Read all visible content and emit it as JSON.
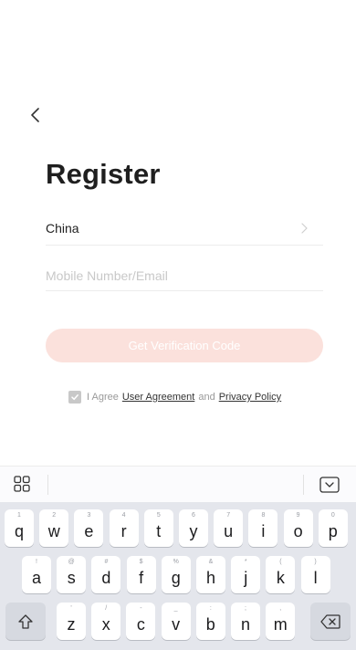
{
  "page": {
    "title": "Register",
    "country": "China",
    "account_placeholder": "Mobile Number/Email",
    "get_code_label": "Get Verification Code",
    "agree": {
      "prefix": "I Agree",
      "user_agreement": "User Agreement",
      "and": "and",
      "privacy_policy": "Privacy Policy",
      "checked": true
    }
  },
  "keyboard": {
    "toolbar": {
      "left_icon": "grid-icon",
      "right_icon": "hide-keyboard-icon"
    },
    "row1": [
      {
        "main": "q",
        "sub": "1"
      },
      {
        "main": "w",
        "sub": "2"
      },
      {
        "main": "e",
        "sub": "3"
      },
      {
        "main": "r",
        "sub": "4"
      },
      {
        "main": "t",
        "sub": "5"
      },
      {
        "main": "y",
        "sub": "6"
      },
      {
        "main": "u",
        "sub": "7"
      },
      {
        "main": "i",
        "sub": "8"
      },
      {
        "main": "o",
        "sub": "9"
      },
      {
        "main": "p",
        "sub": "0"
      }
    ],
    "row2": [
      {
        "main": "a",
        "sub": "!"
      },
      {
        "main": "s",
        "sub": "@"
      },
      {
        "main": "d",
        "sub": "#"
      },
      {
        "main": "f",
        "sub": "$"
      },
      {
        "main": "g",
        "sub": "%"
      },
      {
        "main": "h",
        "sub": "&"
      },
      {
        "main": "j",
        "sub": "*"
      },
      {
        "main": "k",
        "sub": "("
      },
      {
        "main": "l",
        "sub": ")"
      }
    ],
    "row3": [
      {
        "main": "z",
        "sub": "'"
      },
      {
        "main": "x",
        "sub": "/"
      },
      {
        "main": "c",
        "sub": "-"
      },
      {
        "main": "v",
        "sub": "_"
      },
      {
        "main": "b",
        "sub": ":"
      },
      {
        "main": "n",
        "sub": ";"
      },
      {
        "main": "m",
        "sub": ","
      }
    ],
    "shift_icon": "shift-icon",
    "backspace_icon": "backspace-icon"
  },
  "colors": {
    "button_bg": "#fbe1dc",
    "keyboard_bg": "#e4e6ec"
  }
}
